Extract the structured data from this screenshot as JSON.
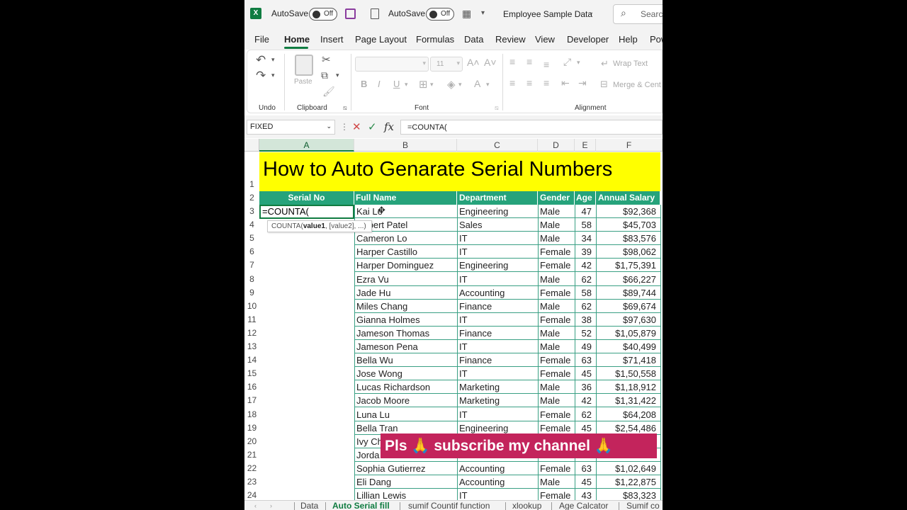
{
  "titlebar": {
    "app_icon": "excel-icon",
    "autosave1_label": "AutoSave",
    "autosave1_state": "Off",
    "autosave2_label": "AutoSave",
    "autosave2_state": "Off",
    "file_name": "Employee Sample Data",
    "search_placeholder": "Search"
  },
  "menu": {
    "tabs": [
      "File",
      "Home",
      "Insert",
      "Page Layout",
      "Formulas",
      "Data",
      "Review",
      "View",
      "Developer",
      "Help",
      "Pow"
    ],
    "active": "Home"
  },
  "ribbon": {
    "undo_label": "Undo",
    "clipboard_label": "Clipboard",
    "paste_label": "Paste",
    "font_label": "Font",
    "font_size": "11",
    "alignment_label": "Alignment",
    "wrap_text": "Wrap Text",
    "merge_center": "Merge & Cent"
  },
  "formula_bar": {
    "name_box": "FIXED",
    "formula": "=COUNTA("
  },
  "columns": [
    "A",
    "B",
    "C",
    "D",
    "E",
    "F"
  ],
  "sheet": {
    "title": "How to Auto Genarate  Serial Numbers",
    "headers": [
      "Serial No",
      "Full Name",
      "Department",
      "Gender",
      "Age",
      "Annual Salary"
    ],
    "active_cell_text": "=COUNTA(",
    "tooltip_fn": "COUNTA(",
    "tooltip_bold": "value1",
    "tooltip_rest": ", [value2], ...)",
    "rows": [
      {
        "n": "3",
        "name": "Kai Le",
        "dept": "Engineering",
        "gender": "Male",
        "age": "47",
        "salary": "$92,368"
      },
      {
        "n": "4",
        "name": "Robert Patel",
        "dept": "Sales",
        "gender": "Male",
        "age": "58",
        "salary": "$45,703"
      },
      {
        "n": "5",
        "name": "Cameron Lo",
        "dept": "IT",
        "gender": "Male",
        "age": "34",
        "salary": "$83,576"
      },
      {
        "n": "6",
        "name": "Harper Castillo",
        "dept": "IT",
        "gender": "Female",
        "age": "39",
        "salary": "$98,062"
      },
      {
        "n": "7",
        "name": "Harper Dominguez",
        "dept": "Engineering",
        "gender": "Female",
        "age": "42",
        "salary": "$1,75,391"
      },
      {
        "n": "8",
        "name": "Ezra Vu",
        "dept": "IT",
        "gender": "Male",
        "age": "62",
        "salary": "$66,227"
      },
      {
        "n": "9",
        "name": "Jade Hu",
        "dept": "Accounting",
        "gender": "Female",
        "age": "58",
        "salary": "$89,744"
      },
      {
        "n": "10",
        "name": "Miles Chang",
        "dept": "Finance",
        "gender": "Male",
        "age": "62",
        "salary": "$69,674"
      },
      {
        "n": "11",
        "name": "Gianna Holmes",
        "dept": "IT",
        "gender": "Female",
        "age": "38",
        "salary": "$97,630"
      },
      {
        "n": "12",
        "name": "Jameson Thomas",
        "dept": "Finance",
        "gender": "Male",
        "age": "52",
        "salary": "$1,05,879"
      },
      {
        "n": "13",
        "name": "Jameson Pena",
        "dept": "IT",
        "gender": "Male",
        "age": "49",
        "salary": "$40,499"
      },
      {
        "n": "14",
        "name": "Bella Wu",
        "dept": "Finance",
        "gender": "Female",
        "age": "63",
        "salary": "$71,418"
      },
      {
        "n": "15",
        "name": "Jose Wong",
        "dept": "IT",
        "gender": "Female",
        "age": "45",
        "salary": "$1,50,558"
      },
      {
        "n": "16",
        "name": "Lucas Richardson",
        "dept": "Marketing",
        "gender": "Male",
        "age": "36",
        "salary": "$1,18,912"
      },
      {
        "n": "17",
        "name": "Jacob Moore",
        "dept": "Marketing",
        "gender": "Male",
        "age": "42",
        "salary": "$1,31,422"
      },
      {
        "n": "18",
        "name": "Luna Lu",
        "dept": "IT",
        "gender": "Female",
        "age": "62",
        "salary": "$64,208"
      },
      {
        "n": "19",
        "name": "Bella Tran",
        "dept": "Engineering",
        "gender": "Female",
        "age": "45",
        "salary": "$2,54,486"
      },
      {
        "n": "20",
        "name": "Ivy Ch",
        "dept": "",
        "gender": "",
        "age": "",
        "salary": ""
      },
      {
        "n": "21",
        "name": "Jorda",
        "dept": "",
        "gender": "",
        "age": "",
        "salary": ""
      },
      {
        "n": "22",
        "name": "Sophia Gutierrez",
        "dept": "Accounting",
        "gender": "Female",
        "age": "63",
        "salary": "$1,02,649"
      },
      {
        "n": "23",
        "name": "Eli Dang",
        "dept": "Accounting",
        "gender": "Male",
        "age": "45",
        "salary": "$1,22,875"
      },
      {
        "n": "24",
        "name": "Lillian Lewis",
        "dept": "IT",
        "gender": "Female",
        "age": "43",
        "salary": "$83,323"
      }
    ]
  },
  "banner": "Pls 🙏 subscribe my channel 🙏",
  "sheet_tabs": [
    "Data",
    "Auto Serial fill",
    "sumif Countif function",
    "xlookup",
    "Age Calcator",
    "Sumif co"
  ],
  "active_sheet": "Auto Serial fill",
  "colors": {
    "accent": "#107c41",
    "header_green": "#26a37b",
    "title_yellow": "#ffff00",
    "banner": "#c3245c"
  }
}
